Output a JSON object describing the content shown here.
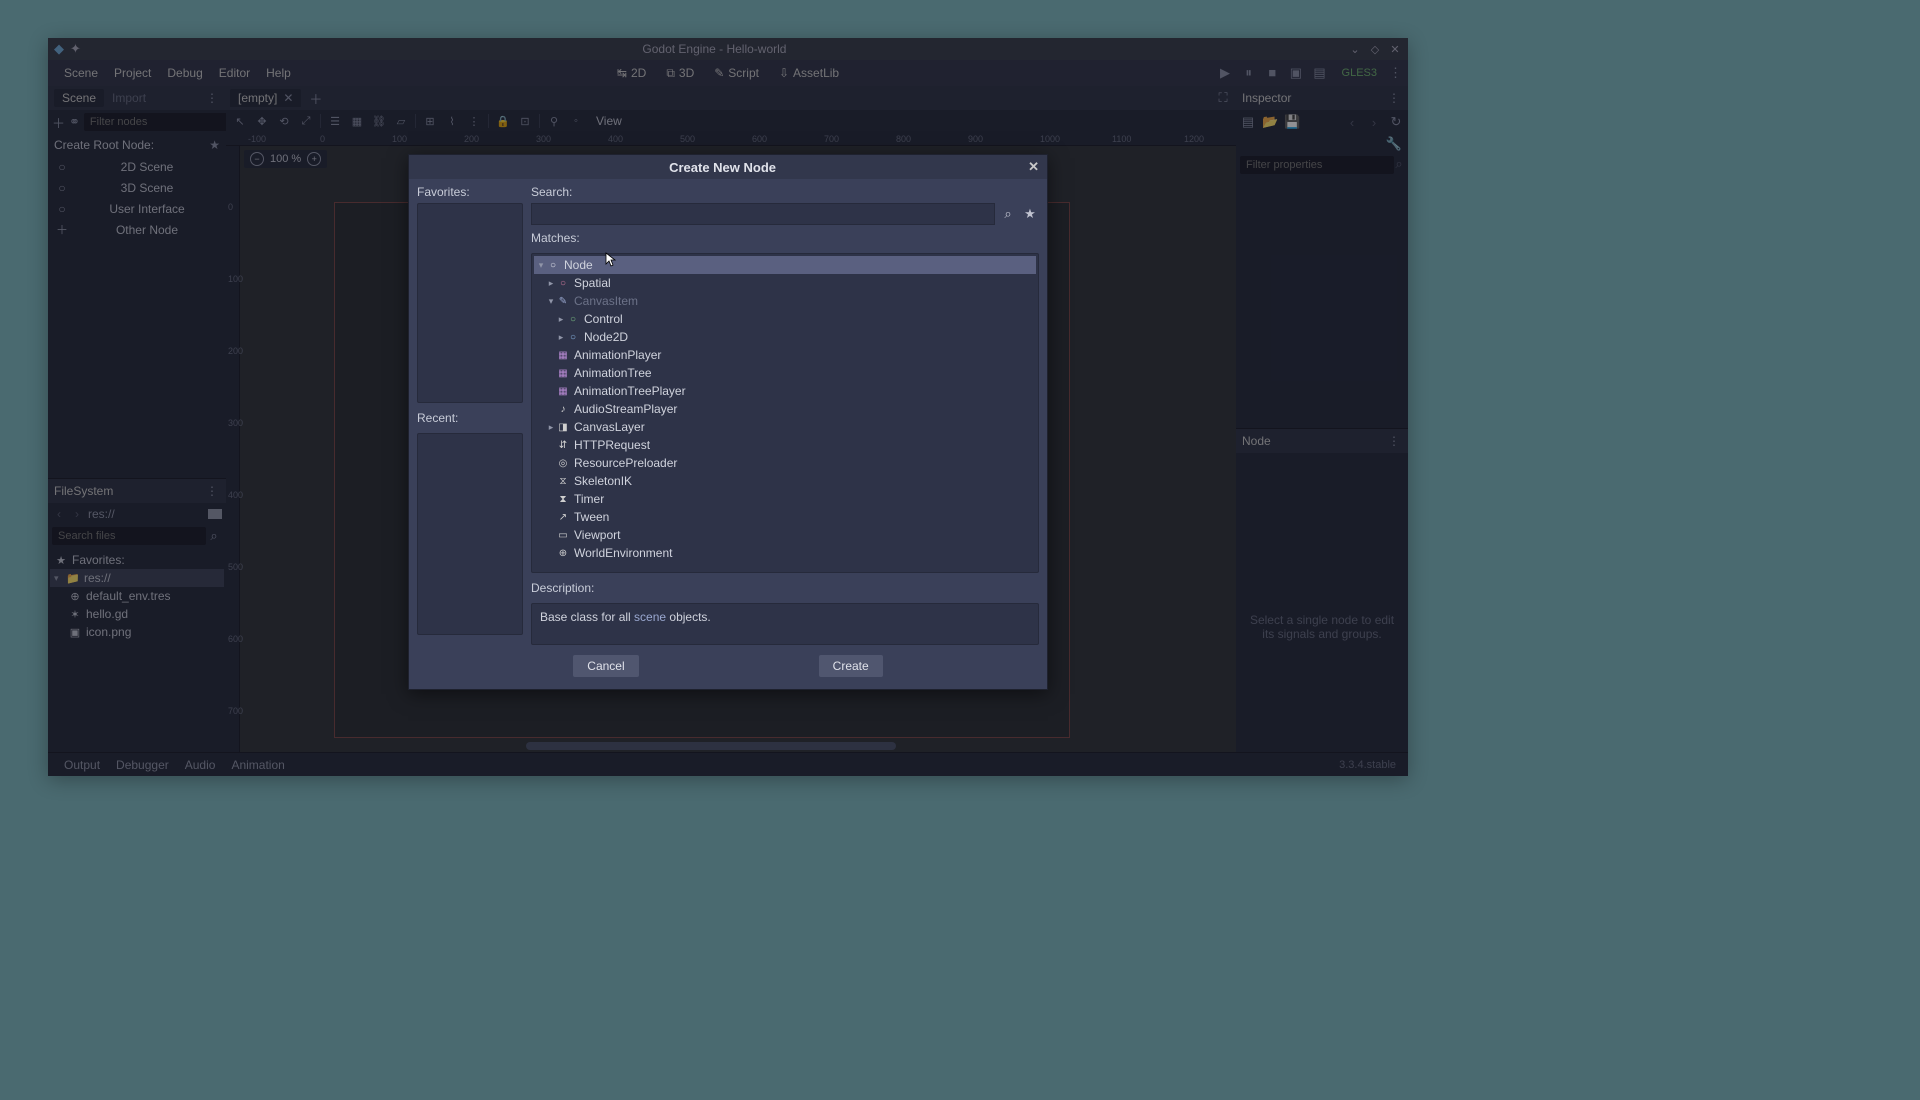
{
  "titlebar": {
    "title": "Godot Engine - Hello-world"
  },
  "menubar": {
    "items": [
      "Scene",
      "Project",
      "Debug",
      "Editor",
      "Help"
    ],
    "center": [
      {
        "icon": "↔",
        "label": "2D"
      },
      {
        "icon": "⧉",
        "label": "3D"
      },
      {
        "icon": "✎",
        "label": "Script"
      },
      {
        "icon": "⇩",
        "label": "AssetLib"
      }
    ],
    "gles": "GLES3"
  },
  "scene": {
    "tabs": {
      "scene": "Scene",
      "import": "Import"
    },
    "filter_placeholder": "Filter nodes",
    "root_label": "Create Root Node:",
    "root_buttons": [
      {
        "icon": "○",
        "label": "2D Scene"
      },
      {
        "icon": "○",
        "label": "3D Scene"
      },
      {
        "icon": "○",
        "label": "User Interface"
      },
      {
        "icon": "＋",
        "label": "Other Node"
      }
    ]
  },
  "filesystem": {
    "title": "FileSystem",
    "path": "res://",
    "search_placeholder": "Search files",
    "favorites": "Favorites:",
    "tree": [
      {
        "icon": "▾",
        "fic": "📁",
        "label": "res://",
        "sel": true,
        "indent": 0
      },
      {
        "icon": "",
        "fic": "⊕",
        "label": "default_env.tres",
        "indent": 1
      },
      {
        "icon": "",
        "fic": "✶",
        "label": "hello.gd",
        "indent": 1
      },
      {
        "icon": "",
        "fic": "▣",
        "label": "icon.png",
        "indent": 1
      }
    ]
  },
  "editor": {
    "tab_label": "[empty]",
    "view_label": "View",
    "zoom": "100 %",
    "ruler_h": [
      "-100",
      "0",
      "100",
      "200",
      "300",
      "400",
      "500",
      "600",
      "700",
      "800",
      "900",
      "1000",
      "1100",
      "1200"
    ],
    "ruler_v": [
      "0",
      "100",
      "200",
      "300",
      "400",
      "500",
      "600",
      "700"
    ]
  },
  "inspector": {
    "title": "Inspector",
    "filter_placeholder": "Filter properties",
    "node_title": "Node",
    "node_empty": "Select a single node to edit its signals and groups."
  },
  "bottom": {
    "items": [
      "Output",
      "Debugger",
      "Audio",
      "Animation"
    ],
    "version": "3.3.4.stable"
  },
  "dialog": {
    "title": "Create New Node",
    "labels": {
      "favorites": "Favorites:",
      "search": "Search:",
      "matches": "Matches:",
      "recent": "Recent:",
      "description": "Description:"
    },
    "description_pre": "Base class for all ",
    "description_em": "scene",
    "description_post": " objects.",
    "buttons": {
      "cancel": "Cancel",
      "create": "Create"
    },
    "nodes": [
      {
        "depth": 0,
        "toggle": "▾",
        "icon": "○",
        "iconColor": "#e0e2ea",
        "label": "Node",
        "sel": true
      },
      {
        "depth": 1,
        "toggle": "▸",
        "icon": "○",
        "iconColor": "#d07a9e",
        "label": "Spatial"
      },
      {
        "depth": 1,
        "toggle": "▾",
        "icon": "✎",
        "iconColor": "#9aa8d0",
        "label": "CanvasItem",
        "dim": true
      },
      {
        "depth": 2,
        "toggle": "▸",
        "icon": "○",
        "iconColor": "#7abf82",
        "label": "Control"
      },
      {
        "depth": 2,
        "toggle": "▸",
        "icon": "○",
        "iconColor": "#8ab8e6",
        "label": "Node2D"
      },
      {
        "depth": 1,
        "toggle": "",
        "icon": "▦",
        "iconColor": "#b88ad4",
        "label": "AnimationPlayer"
      },
      {
        "depth": 1,
        "toggle": "",
        "icon": "▦",
        "iconColor": "#b88ad4",
        "label": "AnimationTree"
      },
      {
        "depth": 1,
        "toggle": "",
        "icon": "▦",
        "iconColor": "#b88ad4",
        "label": "AnimationTreePlayer"
      },
      {
        "depth": 1,
        "toggle": "",
        "icon": "♪",
        "iconColor": "#cfcfcf",
        "label": "AudioStreamPlayer"
      },
      {
        "depth": 1,
        "toggle": "▸",
        "icon": "◨",
        "iconColor": "#cfcfcf",
        "label": "CanvasLayer"
      },
      {
        "depth": 1,
        "toggle": "",
        "icon": "⇵",
        "iconColor": "#cfcfcf",
        "label": "HTTPRequest"
      },
      {
        "depth": 1,
        "toggle": "",
        "icon": "◎",
        "iconColor": "#cfcfcf",
        "label": "ResourcePreloader"
      },
      {
        "depth": 1,
        "toggle": "",
        "icon": "⧖",
        "iconColor": "#cfcfcf",
        "label": "SkeletonIK"
      },
      {
        "depth": 1,
        "toggle": "",
        "icon": "⧗",
        "iconColor": "#cfcfcf",
        "label": "Timer"
      },
      {
        "depth": 1,
        "toggle": "",
        "icon": "↗",
        "iconColor": "#cfcfcf",
        "label": "Tween"
      },
      {
        "depth": 1,
        "toggle": "",
        "icon": "▭",
        "iconColor": "#cfcfcf",
        "label": "Viewport"
      },
      {
        "depth": 1,
        "toggle": "",
        "icon": "⊕",
        "iconColor": "#cfcfcf",
        "label": "WorldEnvironment"
      }
    ]
  }
}
